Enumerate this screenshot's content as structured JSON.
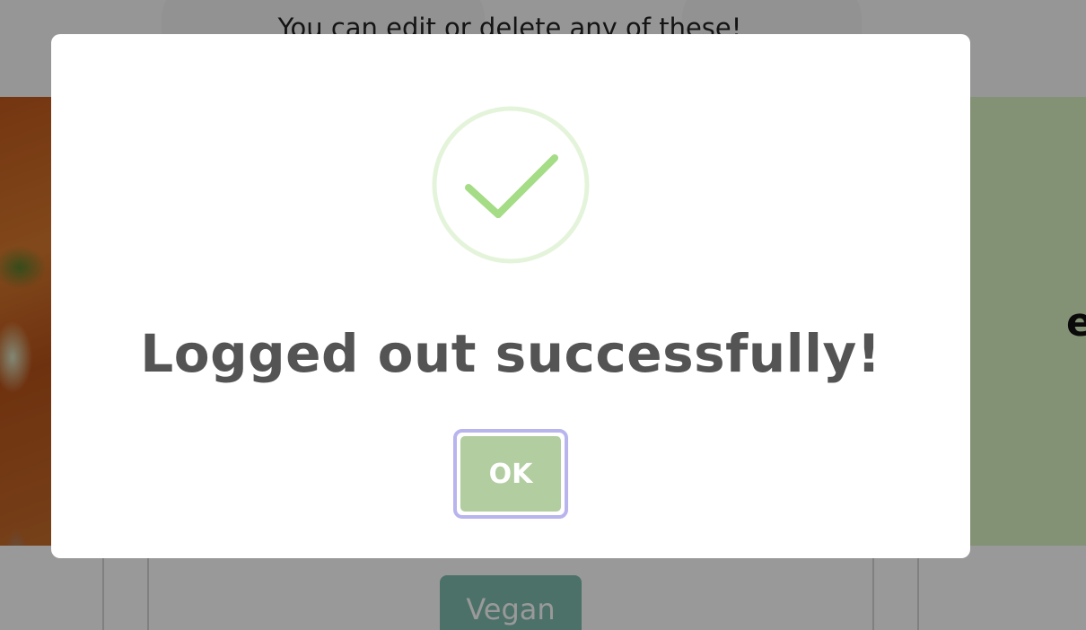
{
  "background": {
    "subtitle": "You can edit or delete any of these!",
    "panel_heading_partial": "e",
    "tag_label": "Vegan"
  },
  "dialog": {
    "title": "Logged out successfully!",
    "icon": "success-check-icon",
    "confirm_label": "OK"
  },
  "colors": {
    "overlay": "rgba(0,0,0,0.4)",
    "check": "#a5dc86",
    "check_ring": "rgba(165,220,134,0.3)",
    "title": "#545454",
    "ok_button": "#b2cda0",
    "ok_focus_ring": "#b8b4ee",
    "tag": "#7fbdae",
    "panel": "#dbf2c3"
  }
}
